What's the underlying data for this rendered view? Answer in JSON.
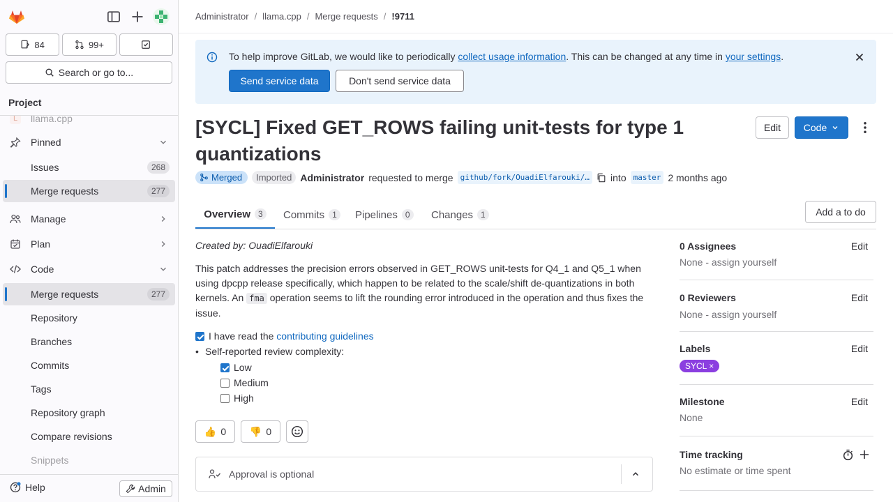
{
  "sidebar": {
    "counts": {
      "issues": "84",
      "mrs": "99+"
    },
    "search_label": "Search or go to...",
    "section_title": "Project",
    "project_name": "llama.cpp",
    "pinned": "Pinned",
    "items": {
      "pinned_issues": {
        "label": "Issues",
        "badge": "268"
      },
      "pinned_mrs": {
        "label": "Merge requests",
        "badge": "277"
      },
      "manage": "Manage",
      "plan": "Plan",
      "code": "Code",
      "code_mrs": {
        "label": "Merge requests",
        "badge": "277"
      },
      "repository": "Repository",
      "branches": "Branches",
      "commits": "Commits",
      "tags": "Tags",
      "repo_graph": "Repository graph",
      "compare": "Compare revisions",
      "snippets": "Snippets"
    },
    "help": "Help",
    "admin": "Admin"
  },
  "breadcrumb": [
    "Administrator",
    "llama.cpp",
    "Merge requests",
    "!9711"
  ],
  "banner": {
    "text1": "To help improve GitLab, we would like to periodically ",
    "link1": "collect usage information",
    "text2": ". This can be changed at any time in ",
    "link2": "your settings",
    "text3": ".",
    "send": "Send service data",
    "dont_send": "Don't send service data"
  },
  "mr": {
    "title": "[SYCL] Fixed GET_ROWS failing unit-tests for type 1 quantizations",
    "edit": "Edit",
    "code": "Code",
    "status": "Merged",
    "imported": "Imported",
    "author": "Administrator",
    "requested": "requested to merge",
    "source_branch": "github/fork/OuadiElfarouki/…",
    "into": "into",
    "target_branch": "master",
    "time": "2 months ago"
  },
  "tabs": [
    {
      "label": "Overview",
      "count": "3"
    },
    {
      "label": "Commits",
      "count": "1"
    },
    {
      "label": "Pipelines",
      "count": "0"
    },
    {
      "label": "Changes",
      "count": "1"
    }
  ],
  "add_todo": "Add a to do",
  "description": {
    "created_by": "Created by: OuadiElfarouki",
    "p1_a": "This patch addresses the precision errors observed in GET_ROWS unit-tests for Q4_1 and Q5_1 when using dpcpp release specifically, which happen to be related to the scale/shift de-quantizations in both kernels. An ",
    "p1_code": "fma",
    "p1_b": " operation seems to lift the rounding error introduced in the operation and thus fixes the issue.",
    "read_a": "I have read the ",
    "read_link": "contributing guidelines",
    "complexity": "Self-reported review complexity:",
    "low": "Low",
    "medium": "Medium",
    "high": "High"
  },
  "reactions": {
    "up": "0",
    "down": "0"
  },
  "approval": "Approval is optional",
  "side": {
    "assignees": "0 Assignees",
    "assignees_val": "None - assign yourself",
    "reviewers": "0 Reviewers",
    "reviewers_val": "None - assign yourself",
    "labels": "Labels",
    "label_sycl": "SYCL",
    "milestone": "Milestone",
    "milestone_val": "None",
    "time_tracking": "Time tracking",
    "time_val": "No estimate or time spent",
    "edit": "Edit"
  }
}
